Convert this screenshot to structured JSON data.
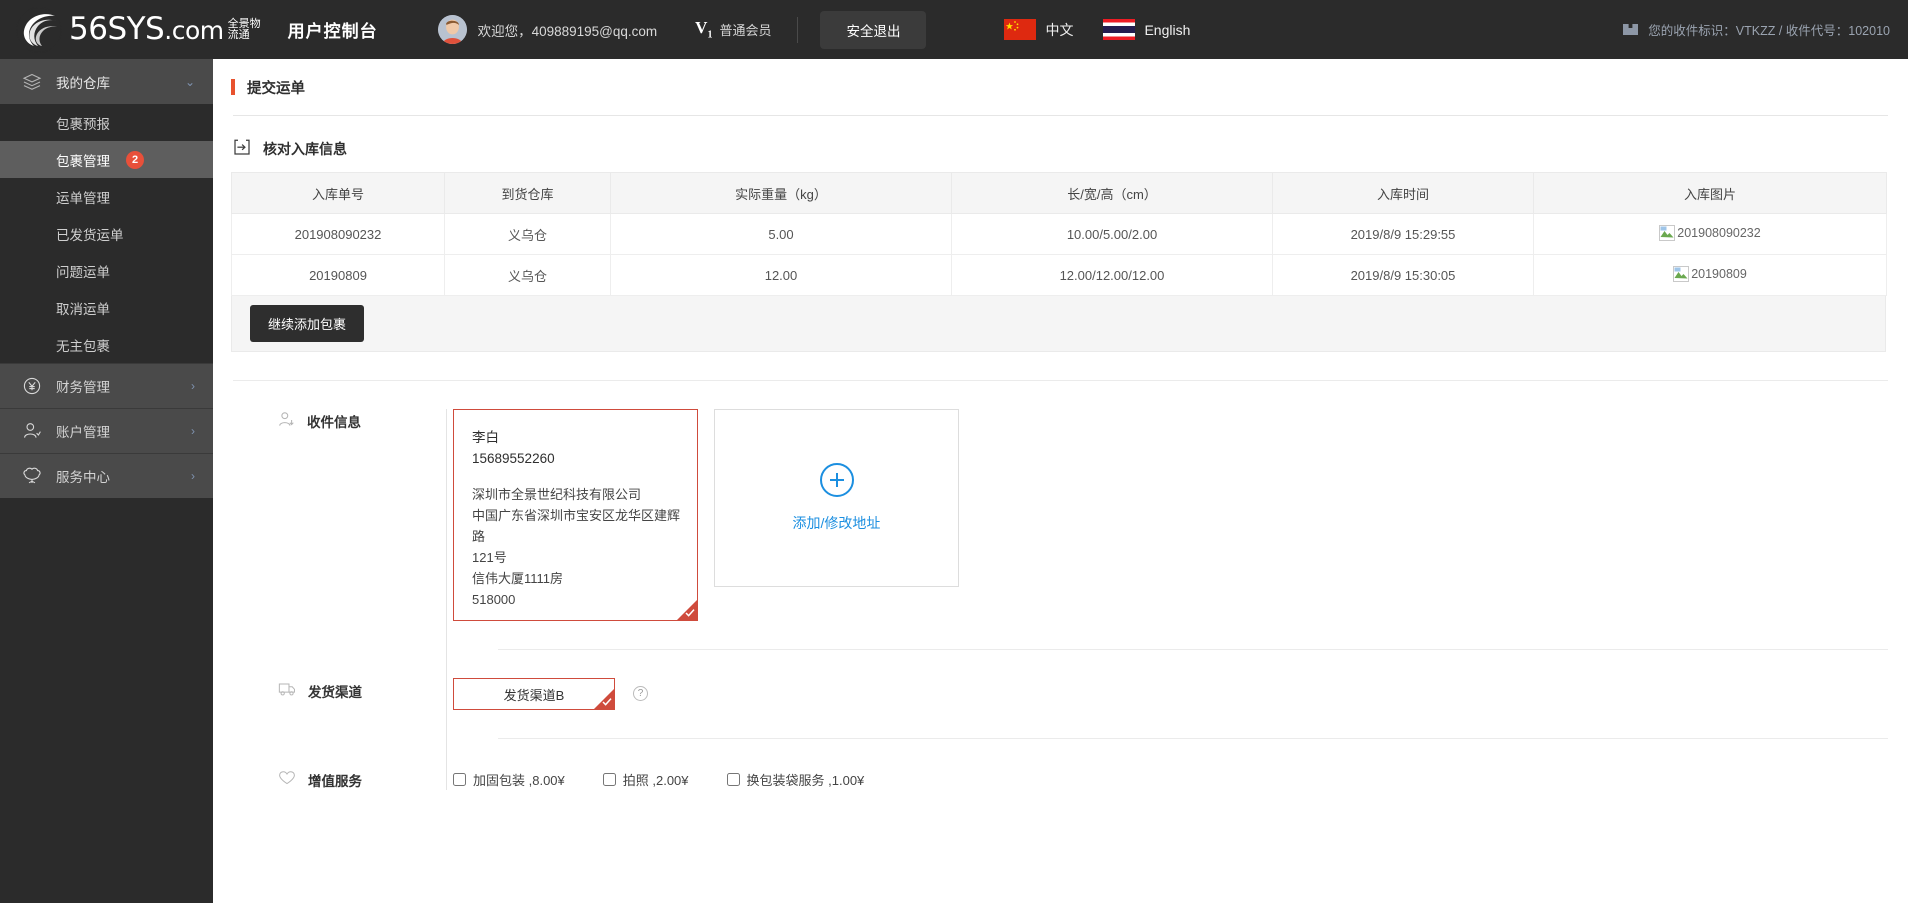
{
  "topbar": {
    "logo_main": "56SYS",
    "logo_dotcom": ".com",
    "logo_cn": "全景物流通",
    "console_title": "用户控制台",
    "welcome": "欢迎您，409889195@qq.com",
    "vip_mark": "V",
    "vip_sub": "1",
    "vip_label": "普通会员",
    "logout": "安全退出",
    "languages": [
      {
        "flag": "cn-flag-icon",
        "label": "中文"
      },
      {
        "flag": "th-flag-icon",
        "label": "English"
      }
    ],
    "identifier": "您的收件标识：VTKZZ / 收件代号：102010"
  },
  "sidebar": {
    "group": {
      "label": "我的仓库",
      "icon": "layers-icon",
      "chevron": "chevron-down-icon",
      "items": [
        {
          "label": "包裹预报",
          "badge": "",
          "active": false
        },
        {
          "label": "包裹管理",
          "badge": "2",
          "active": true
        },
        {
          "label": "运单管理",
          "badge": "",
          "active": false
        },
        {
          "label": "已发货运单",
          "badge": "",
          "active": false
        },
        {
          "label": "问题运单",
          "badge": "",
          "active": false
        },
        {
          "label": "取消运单",
          "badge": "",
          "active": false
        },
        {
          "label": "无主包裹",
          "badge": "",
          "active": false
        }
      ]
    },
    "rows": [
      {
        "label": "财务管理",
        "icon": "yuan-circle-icon"
      },
      {
        "label": "账户管理",
        "icon": "user-icon"
      },
      {
        "label": "服务中心",
        "icon": "shield-icon"
      }
    ]
  },
  "main": {
    "page_title": "提交运单",
    "section": {
      "icon": "inbound-box-icon",
      "title": "核对入库信息"
    },
    "table": {
      "headers": [
        "入库单号",
        "到货仓库",
        "实际重量（kg）",
        "长/宽/高（cm）",
        "入库时间",
        "入库图片"
      ],
      "rows": [
        {
          "no": "201908090232",
          "warehouse": "义乌仓",
          "weight": "5.00",
          "dims": "10.00/5.00/2.00",
          "time": "2019/8/9 15:29:55",
          "image_alt": "201908090232"
        },
        {
          "no": "20190809",
          "warehouse": "义乌仓",
          "weight": "12.00",
          "dims": "12.00/12.00/12.00",
          "time": "2019/8/9 15:30:05",
          "image_alt": "20190809"
        }
      ]
    },
    "add_package_button": "继续添加包裹",
    "recipient": {
      "icon": "recipient-icon",
      "label": "收件信息",
      "card": {
        "name": "李白",
        "phone": "15689552260",
        "lines": [
          "深圳市全景世纪科技有限公司",
          "中国广东省深圳市宝安区龙华区建辉路",
          "121号",
          "信伟大厦1111房",
          "518000"
        ]
      },
      "add_label": "添加/修改地址"
    },
    "channel": {
      "icon": "truck-icon",
      "label": "发货渠道",
      "selected": "发货渠道B",
      "help": "?"
    },
    "vas": {
      "icon": "heart-icon",
      "label": "增值服务",
      "items": [
        {
          "label": "加固包装 ,8.00¥",
          "checked": false
        },
        {
          "label": "拍照 ,2.00¥",
          "checked": false
        },
        {
          "label": "换包装袋服务 ,1.00¥",
          "checked": false
        }
      ]
    }
  },
  "colors": {
    "accent_red": "#cf4b3c",
    "title_bar": "#e8522e",
    "badge_red": "#e8503a",
    "link_blue": "#1c8fe0",
    "dark_bg": "#2b2b2b"
  }
}
